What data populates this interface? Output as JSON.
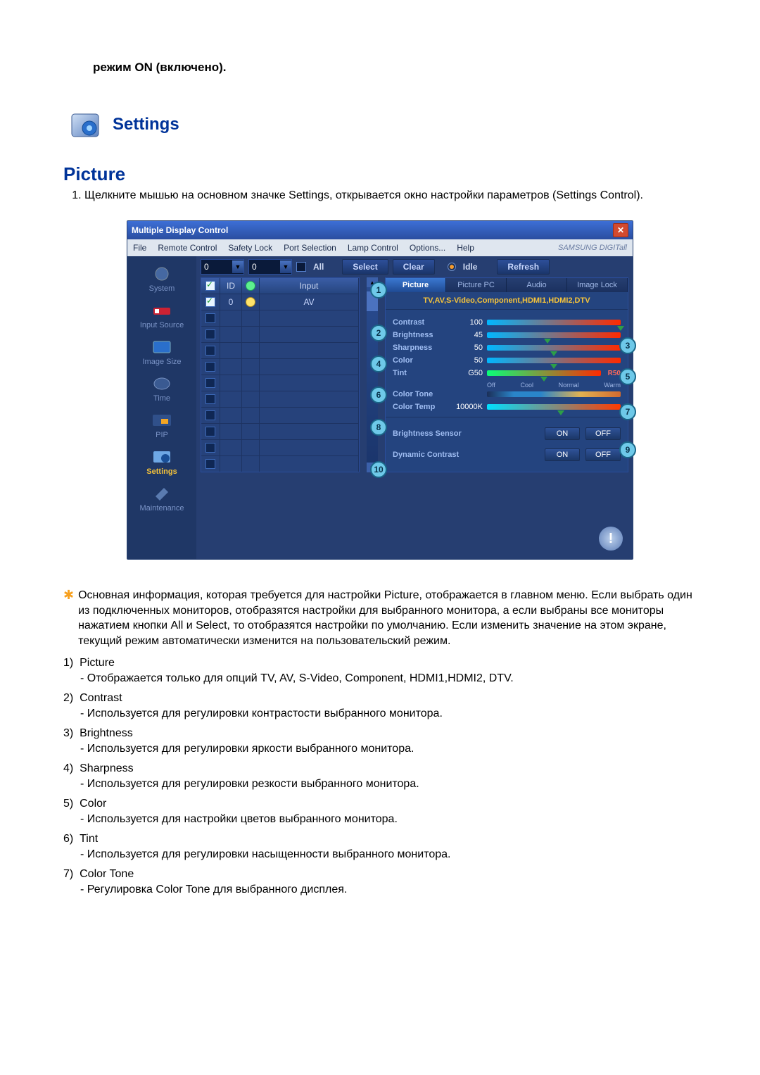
{
  "top_note": "режим ON (включено).",
  "section_title": "Settings",
  "page_heading": "Picture",
  "intro": "Щелкните мышью на основном значке Settings, открывается окно настройки параметров (Settings Control).",
  "app": {
    "title": "Multiple Display Control",
    "close": "✕",
    "menu": [
      "File",
      "Remote Control",
      "Safety Lock",
      "Port Selection",
      "Lamp Control",
      "Options...",
      "Help"
    ],
    "brand": "SAMSUNG DIGITall",
    "sidebar": [
      {
        "label": "System",
        "active": false
      },
      {
        "label": "Input Source",
        "active": false
      },
      {
        "label": "Image Size",
        "active": false
      },
      {
        "label": "Time",
        "active": false
      },
      {
        "label": "PIP",
        "active": false
      },
      {
        "label": "Settings",
        "active": true
      },
      {
        "label": "Maintenance",
        "active": false
      }
    ],
    "toolbar": {
      "sel1": "0",
      "sel2": "0",
      "all_label": "All",
      "select": "Select",
      "clear": "Clear",
      "idle": "Idle",
      "refresh": "Refresh"
    },
    "grid": {
      "headers": [
        "",
        "ID",
        "",
        "Input"
      ],
      "rows": [
        {
          "id": "0",
          "input": "AV"
        }
      ]
    },
    "panel": {
      "tabs": [
        "Picture",
        "Picture PC",
        "Audio",
        "Image Lock"
      ],
      "note": "TV,AV,S-Video,Component,HDMI1,HDMI2,DTV",
      "sliders": {
        "contrast": {
          "label": "Contrast",
          "value": "100",
          "pct": 100
        },
        "brightness": {
          "label": "Brightness",
          "value": "45",
          "pct": 45
        },
        "sharpness": {
          "label": "Sharpness",
          "value": "50",
          "pct": 50
        },
        "color": {
          "label": "Color",
          "value": "50",
          "pct": 50
        },
        "tint": {
          "label": "Tint",
          "value": "G50",
          "right": "R50",
          "pct": 50
        }
      },
      "color_tone": {
        "label": "Color Tone",
        "ticks": [
          "Off",
          "Cool",
          "Normal",
          "Warm"
        ]
      },
      "color_temp": {
        "label": "Color Temp",
        "value": "10000K",
        "pct": 55
      },
      "brightness_sensor": {
        "label": "Brightness Sensor",
        "on": "ON",
        "off": "OFF"
      },
      "dynamic_contrast": {
        "label": "Dynamic Contrast",
        "on": "ON",
        "off": "OFF"
      }
    },
    "callouts": [
      "1",
      "2",
      "3",
      "4",
      "5",
      "6",
      "7",
      "8",
      "9",
      "10"
    ]
  },
  "star_note": "Основная информация, которая требуется для настройки Picture, отображается в главном меню. Если выбрать один из подключенных мониторов, отобразятся настройки для выбранного монитора, а если выбраны все мониторы нажатием кнопки All и Select, то отобразятся настройки по умолчанию. Если изменить значение на этом экране, текущий режим автоматически изменится на пользовательский режим.",
  "items": [
    {
      "n": "1)",
      "t": "Picture",
      "d": "- Отображается только для опций TV, AV, S-Video, Component, HDMI1,HDMI2, DTV."
    },
    {
      "n": "2)",
      "t": "Contrast",
      "d": "- Используется для регулировки контрастости выбранного монитора."
    },
    {
      "n": "3)",
      "t": "Brightness",
      "d": "- Используется для регулировки яркости выбранного монитора."
    },
    {
      "n": "4)",
      "t": "Sharpness",
      "d": "- Используется для регулировки резкости выбранного монитора."
    },
    {
      "n": "5)",
      "t": "Color",
      "d": "- Используется для настройки цветов выбранного монитора."
    },
    {
      "n": "6)",
      "t": "Tint",
      "d": "- Используется для регулировки насыщенности выбранного монитора."
    },
    {
      "n": "7)",
      "t": "Color Tone",
      "d": "- Регулировка Color Tone для выбранного дисплея."
    }
  ]
}
